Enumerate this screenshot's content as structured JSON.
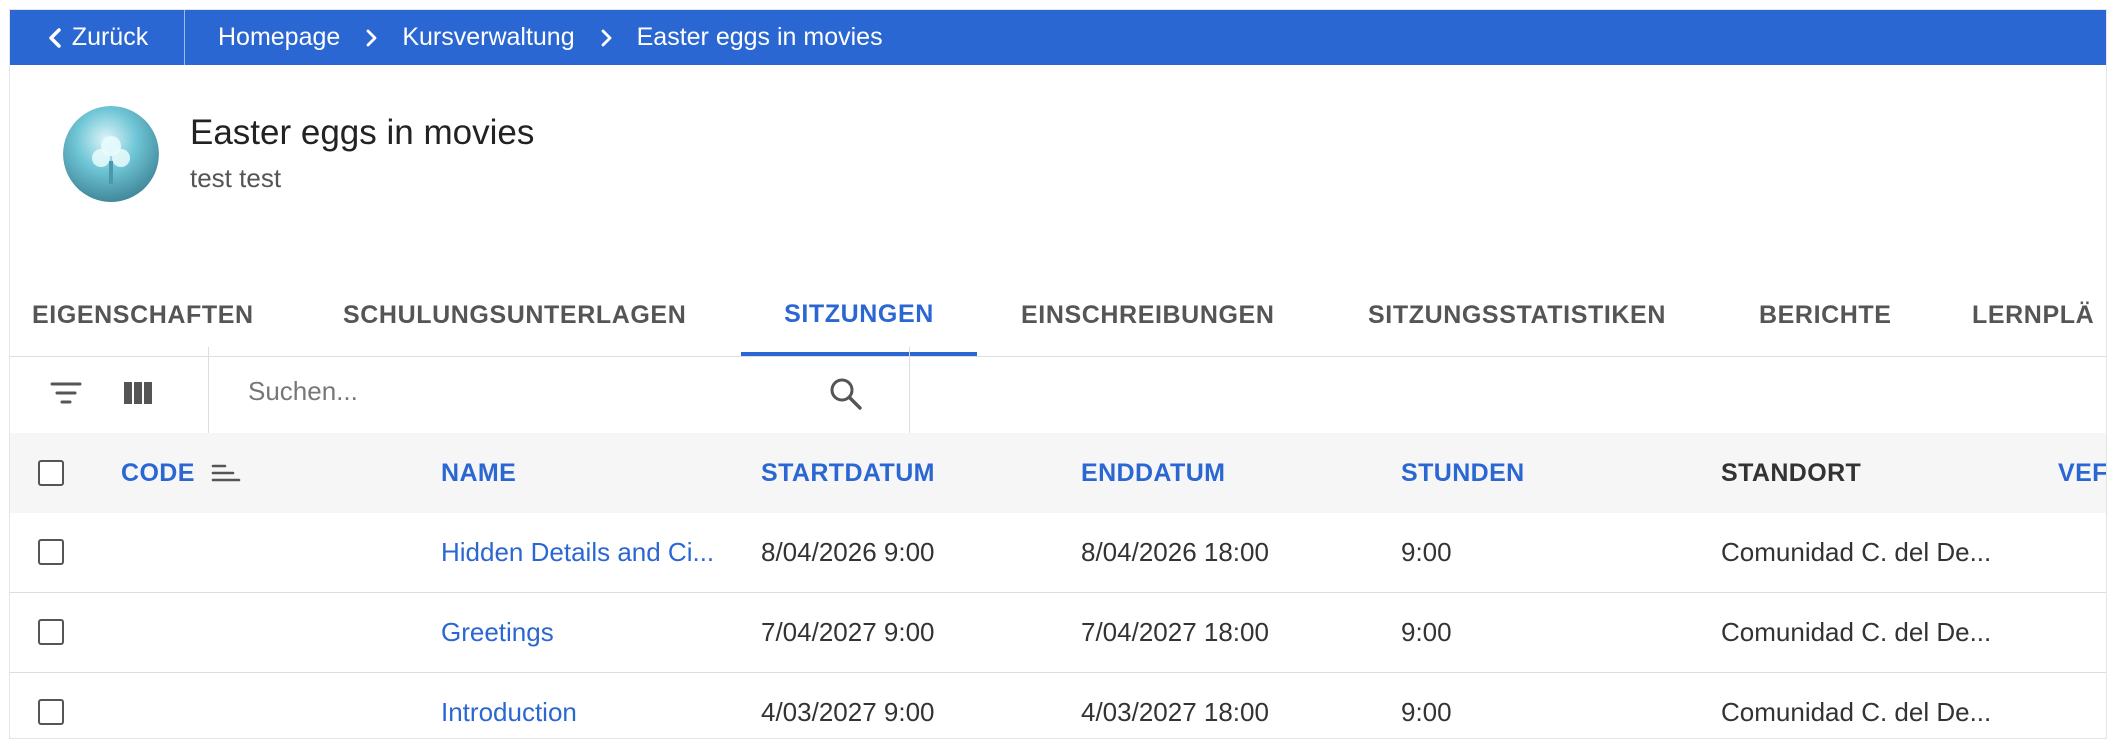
{
  "topbar": {
    "back_label": "Zurück",
    "breadcrumbs": [
      "Homepage",
      "Kursverwaltung",
      "Easter eggs in movies"
    ]
  },
  "course": {
    "title": "Easter eggs in movies",
    "subtitle": "test test"
  },
  "tabs": [
    {
      "label": "EIGENSCHAFTEN",
      "active": false
    },
    {
      "label": "SCHULUNGSUNTERLAGEN",
      "active": false
    },
    {
      "label": "SITZUNGEN",
      "active": true
    },
    {
      "label": "EINSCHREIBUNGEN",
      "active": false
    },
    {
      "label": "SITZUNGSSTATISTIKEN",
      "active": false
    },
    {
      "label": "BERICHTE",
      "active": false
    },
    {
      "label": "LERNPLÄ",
      "active": false
    }
  ],
  "toolbar": {
    "search_placeholder": "Suchen...",
    "filter_icon": "filter-icon",
    "columns_icon": "columns-icon",
    "search_icon": "search-icon"
  },
  "table": {
    "headers": {
      "code": "CODE",
      "name": "NAME",
      "start": "STARTDATUM",
      "end": "ENDDATUM",
      "hours": "STUNDEN",
      "location": "STANDORT",
      "more": "VEF"
    },
    "rows": [
      {
        "code": "",
        "name": "Hidden Details and Ci...",
        "start": "8/04/2026 9:00",
        "end": "8/04/2026 18:00",
        "hours": "9:00",
        "location": "Comunidad C. del De..."
      },
      {
        "code": "",
        "name": "Greetings",
        "start": "7/04/2027 9:00",
        "end": "7/04/2027 18:00",
        "hours": "9:00",
        "location": "Comunidad C. del De..."
      },
      {
        "code": "",
        "name": "Introduction",
        "start": "4/03/2027 9:00",
        "end": "4/03/2027 18:00",
        "hours": "9:00",
        "location": "Comunidad C. del De..."
      }
    ]
  },
  "colors": {
    "accent": "#2b67d2",
    "text": "#333333",
    "divider": "#dedede"
  }
}
